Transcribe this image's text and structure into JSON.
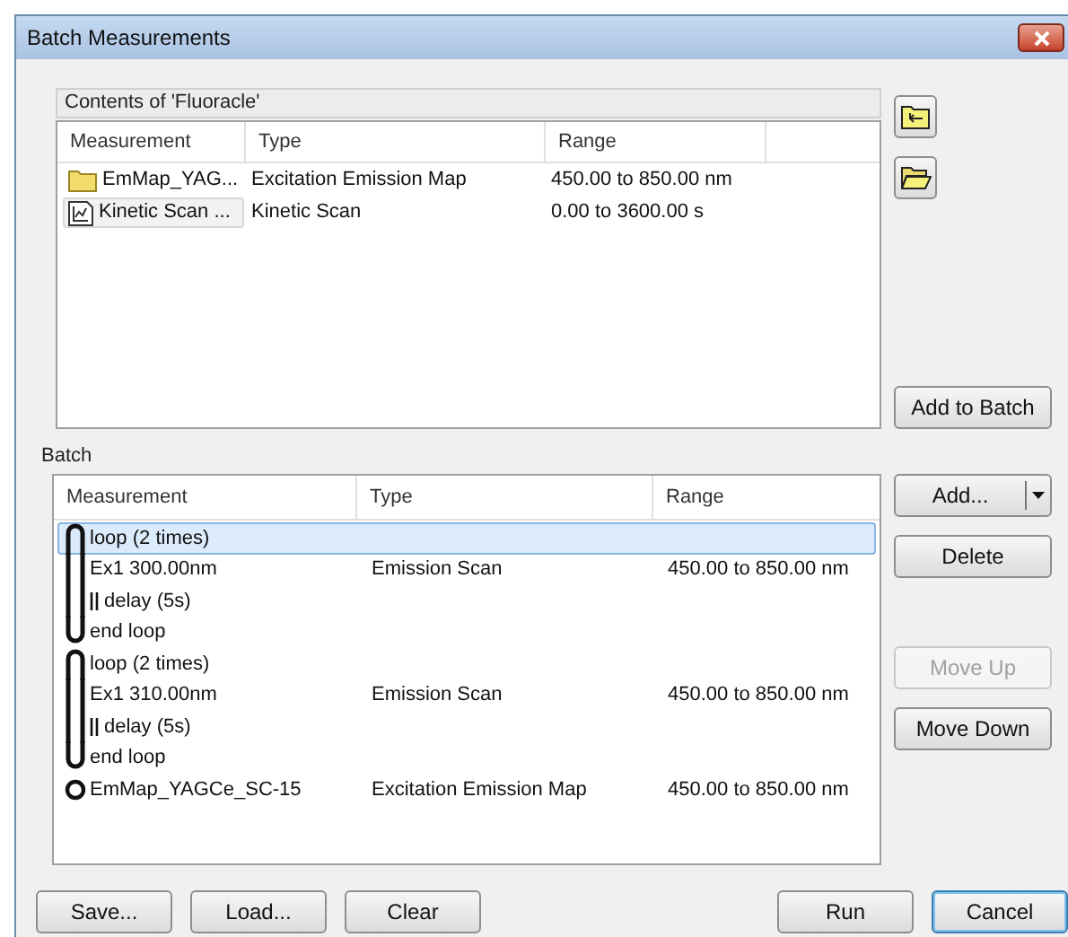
{
  "window": {
    "title": "Batch Measurements"
  },
  "contents": {
    "title": "Contents of 'Fluoracle'",
    "columns": [
      "Measurement",
      "Type",
      "Range"
    ],
    "rows": [
      {
        "kind": "folder",
        "measurement": "EmMap_YAG...",
        "type": "Excitation Emission Map",
        "range": "450.00 to 850.00 nm",
        "focused": false
      },
      {
        "kind": "scan",
        "measurement": "Kinetic Scan ...",
        "type": "Kinetic Scan",
        "range": "0.00 to 3600.00 s",
        "focused": true
      }
    ]
  },
  "contents_buttons": [
    {
      "kind": "up-folder"
    },
    {
      "kind": "open-folder"
    }
  ],
  "add_to_batch": "Add to Batch",
  "batch": {
    "title": "Batch",
    "columns": [
      "Measurement",
      "Type",
      "Range"
    ],
    "rows": [
      {
        "kind": "loop_start",
        "measurement": "loop (2 times)",
        "type": "",
        "range": "",
        "selected": true
      },
      {
        "kind": "step",
        "measurement": "Ex1 300.00nm",
        "type": "Emission Scan",
        "range": "450.00 to 850.00 nm",
        "selected": false
      },
      {
        "kind": "delay",
        "measurement": "delay (5s)",
        "type": "",
        "range": "",
        "selected": false
      },
      {
        "kind": "loop_end",
        "measurement": "end loop",
        "type": "",
        "range": "",
        "selected": false
      },
      {
        "kind": "loop_start",
        "measurement": "loop (2 times)",
        "type": "",
        "range": "",
        "selected": false
      },
      {
        "kind": "step",
        "measurement": "Ex1 310.00nm",
        "type": "Emission Scan",
        "range": "450.00 to 850.00 nm",
        "selected": false
      },
      {
        "kind": "delay",
        "measurement": "delay (5s)",
        "type": "",
        "range": "",
        "selected": false
      },
      {
        "kind": "loop_end",
        "measurement": "end loop",
        "type": "",
        "range": "",
        "selected": false
      },
      {
        "kind": "single",
        "measurement": "EmMap_YAGCe_SC-15",
        "type": "Excitation Emission Map",
        "range": "450.00 to 850.00 nm",
        "selected": false
      }
    ]
  },
  "batch_buttons": [
    {
      "kind": "split",
      "label": "Add...",
      "disabled": false
    },
    {
      "kind": "plain",
      "label": "Delete",
      "disabled": false
    },
    {
      "kind": "gap"
    },
    {
      "kind": "plain",
      "label": "Move Up",
      "disabled": true
    },
    {
      "kind": "plain",
      "label": "Move Down",
      "disabled": false
    }
  ],
  "footer_left": [
    {
      "label": "Save...",
      "default": false
    },
    {
      "label": "Load...",
      "default": false
    },
    {
      "label": "Clear",
      "default": false
    }
  ],
  "footer_right": [
    {
      "label": "Run",
      "default": false
    },
    {
      "label": "Cancel",
      "default": true
    }
  ]
}
